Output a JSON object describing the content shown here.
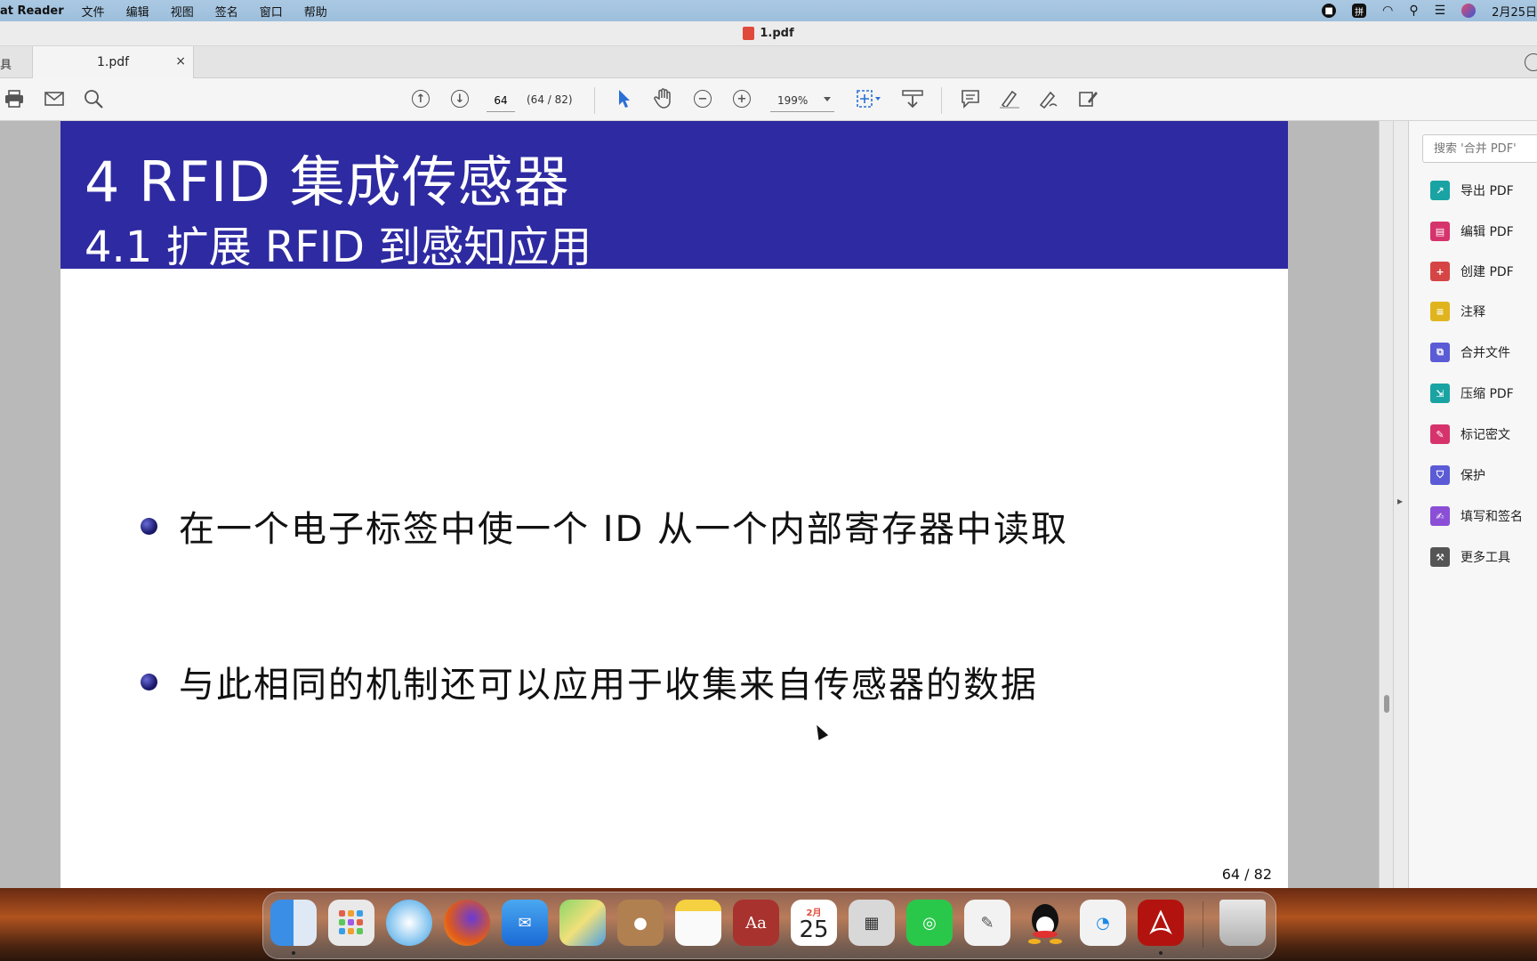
{
  "menubar": {
    "app_name": "at Reader",
    "items": [
      "文件",
      "编辑",
      "视图",
      "签名",
      "窗口",
      "帮助"
    ],
    "date": "2月25日"
  },
  "window": {
    "title": "1.pdf"
  },
  "tabs": {
    "tools_label": "具",
    "active_tab": "1.pdf",
    "close": "×"
  },
  "toolbar": {
    "page_value": "64",
    "page_count": "(64 / 82)",
    "zoom": "199%"
  },
  "slide": {
    "title": "4 RFID 集成传感器",
    "subtitle": "4.1 扩展 RFID 到感知应用",
    "bullets": [
      "在一个电子标签中使一个 ID 从一个内部寄存器中读取",
      "与此相同的机制还可以应用于收集来自传感器的数据"
    ],
    "page_number": "64 / 82"
  },
  "panel": {
    "search_placeholder": "搜索 '合并 PDF'",
    "tools": [
      {
        "label": "导出 PDF",
        "color": "#1aa3a3",
        "icon": "export-pdf-icon"
      },
      {
        "label": "编辑 PDF",
        "color": "#d6336c",
        "icon": "edit-pdf-icon"
      },
      {
        "label": "创建 PDF",
        "color": "#d64545",
        "icon": "create-pdf-icon"
      },
      {
        "label": "注释",
        "color": "#e0b41e",
        "icon": "comment-icon"
      },
      {
        "label": "合并文件",
        "color": "#5b5bd6",
        "icon": "combine-files-icon"
      },
      {
        "label": "压缩 PDF",
        "color": "#1aa3a3",
        "icon": "compress-pdf-icon"
      },
      {
        "label": "标记密文",
        "color": "#d6336c",
        "icon": "redact-icon"
      },
      {
        "label": "保护",
        "color": "#5b5bd6",
        "icon": "protect-icon"
      },
      {
        "label": "填写和签名",
        "color": "#8a4fd6",
        "icon": "fill-sign-icon"
      },
      {
        "label": "更多工具",
        "color": "#555555",
        "icon": "more-tools-icon"
      }
    ]
  },
  "dock": {
    "calendar_month": "2月",
    "calendar_day": "25",
    "dictionary_label": "Aa"
  }
}
